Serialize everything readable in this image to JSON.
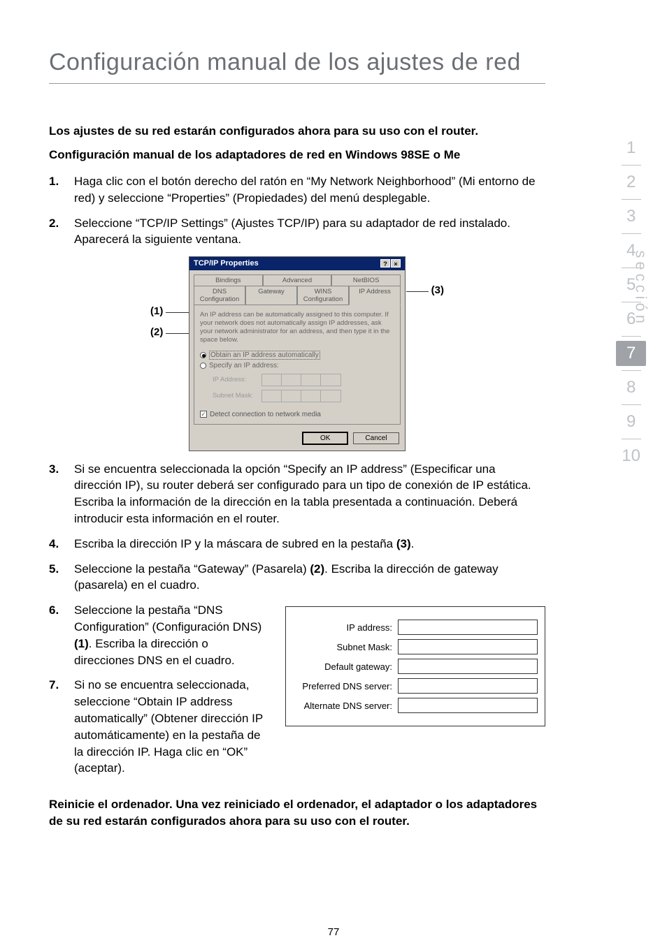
{
  "page_title": "Configuración manual de los ajustes de red",
  "intro_bold_1": "Los ajustes de su red estarán configurados ahora para su uso con el router.",
  "intro_bold_2": "Configuración manual de los adaptadores de red en Windows 98SE o Me",
  "steps_top": [
    "Haga clic con el botón derecho del ratón en “My Network Neighborhood” (Mi entorno de red) y seleccione “Properties” (Propiedades) del menú desplegable.",
    "Seleccione “TCP/IP Settings” (Ajustes TCP/IP) para su adaptador de red instalado. Aparecerá la siguiente ventana."
  ],
  "dialog": {
    "title": "TCP/IP Properties",
    "winhelp": "?",
    "winclose": "×",
    "tabs_row1": [
      "Bindings",
      "Advanced",
      "NetBIOS"
    ],
    "tabs_row2": [
      "DNS Configuration",
      "Gateway",
      "WINS Configuration",
      "IP Address"
    ],
    "desc": "An IP address can be automatically assigned to this computer. If your network does not automatically assign IP addresses, ask your network administrator for an address, and then type it in the space below.",
    "radio_auto": "Obtain an IP address automatically",
    "radio_spec": "Specify an IP address:",
    "ip_label": "IP Address:",
    "mask_label": "Subnet Mask:",
    "detect": "Detect connection to network media",
    "ok": "OK",
    "cancel": "Cancel"
  },
  "callouts": {
    "c1": "(1)",
    "c2": "(2)",
    "c3": "(3)"
  },
  "step3": "Si se encuentra seleccionada la opción “Specify an IP address” (Especificar una dirección IP), su router deberá ser configurado para un tipo de conexión de IP estática. Escriba la información de la dirección en la tabla presentada a continuación. Deberá introducir esta información en el router.",
  "step4_a": "Escriba la dirección IP y la máscara de subred en la pestaña ",
  "step4_b": "(3)",
  "step4_c": ".",
  "step5_a": "Seleccione la pestaña “Gateway” (Pasarela) ",
  "step5_b": "(2)",
  "step5_c": ". Escriba la dirección de gateway (pasarela) en el cuadro.",
  "step6_a": "Seleccione la pestaña “DNS Configuration” (Configuración DNS) ",
  "step6_b": "(1)",
  "step6_c": ". Escriba la dirección o direcciones DNS en el cuadro.",
  "step7": "Si no se encuentra seleccionada, seleccione “Obtain IP address automatically” (Obtener dirección IP automáticamente) en la pestaña de la dirección IP. Haga clic en “OK” (aceptar).",
  "form_labels": [
    "IP address:",
    "Subnet Mask:",
    "Default gateway:",
    "Preferred DNS server:",
    "Alternate DNS server:"
  ],
  "final_bold": "Reinicie el ordenador. Una vez reiniciado el ordenador, el adaptador o los adaptadores de su red estarán configurados ahora para su uso con el router.",
  "nav": [
    "1",
    "2",
    "3",
    "4",
    "5",
    "6",
    "7",
    "8",
    "9",
    "10"
  ],
  "nav_active_index": 6,
  "side_label": "sección",
  "page_number": "77"
}
